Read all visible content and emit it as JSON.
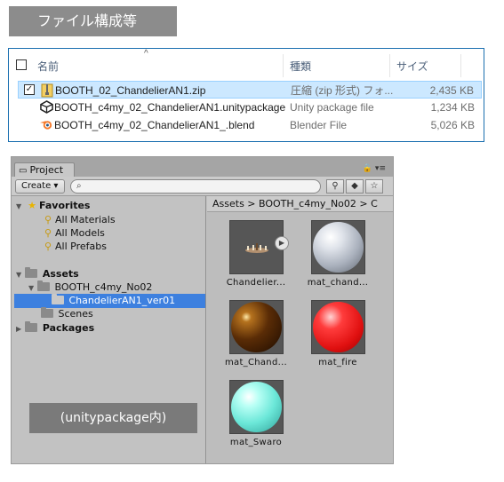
{
  "banner": {
    "title": "ファイル構成等"
  },
  "explorer": {
    "columns": {
      "name": "名前",
      "type": "種類",
      "size": "サイズ"
    },
    "files": [
      {
        "name": "BOOTH_02_ChandelierAN1.zip",
        "type": "圧縮 (zip 形式) フォ...",
        "size": "2,435 KB",
        "icon": "zip-folder-icon",
        "selected": true
      },
      {
        "name": "BOOTH_c4my_02_ChandelierAN1.unitypackage",
        "type": "Unity package file",
        "size": "1,234 KB",
        "icon": "unity-icon",
        "selected": false
      },
      {
        "name": "BOOTH_c4my_02_ChandelierAN1_.blend",
        "type": "Blender File",
        "size": "5,026 KB",
        "icon": "blender-icon",
        "selected": false
      }
    ]
  },
  "unity": {
    "tab_label": "Project",
    "create_label": "Create ▾",
    "search_placeholder": "",
    "tree": {
      "favorites": "Favorites",
      "fav_items": [
        "All Materials",
        "All Models",
        "All Prefabs"
      ],
      "assets": "Assets",
      "booth": "BOOTH_c4my_No02",
      "chandelier": "ChandelierAN1_ver01",
      "scenes": "Scenes",
      "packages": "Packages"
    },
    "breadcrumb": "Assets  >  BOOTH_c4my_No02  >  C",
    "assets": [
      {
        "label": "Chandelier...",
        "kind": "model"
      },
      {
        "label": "mat_chand...",
        "kind": "material",
        "color": "#dfe3ea"
      },
      {
        "label": "mat_Chand...",
        "kind": "material",
        "color": "#5a2c06"
      },
      {
        "label": "mat_fire",
        "kind": "material",
        "color": "#ff3c3c"
      },
      {
        "label": "mat_Swaro",
        "kind": "material",
        "color": "#6be7d8"
      }
    ]
  },
  "caption": "(unitypackage内)"
}
